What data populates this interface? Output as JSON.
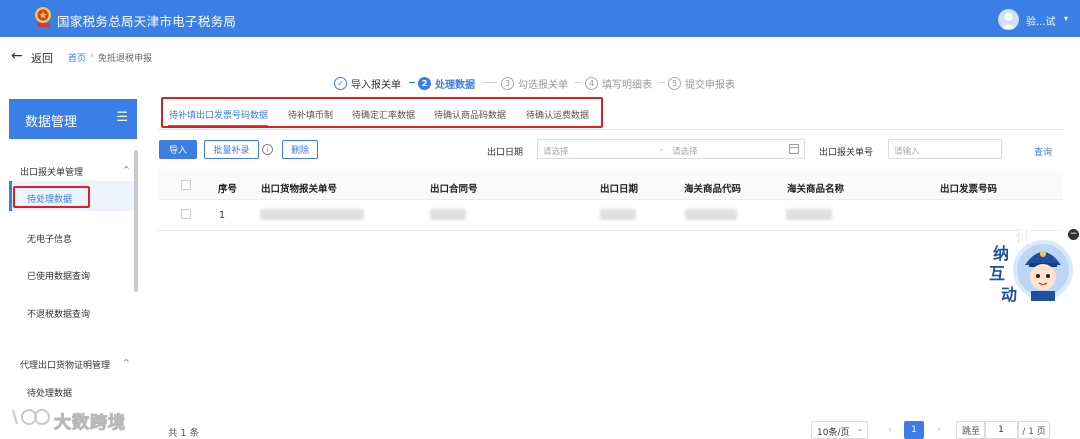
{
  "header": {
    "title": "国家税务总局天津市电子税务局",
    "user_name": "验...试"
  },
  "breadcrumb": {
    "back_label": "返回",
    "home": "首页",
    "separator": "›",
    "current": "免抵退税申报"
  },
  "steps": [
    {
      "num": "✓",
      "label": "导入报关单",
      "state": "done"
    },
    {
      "num": "2",
      "label": "处理数据",
      "state": "active"
    },
    {
      "num": "3",
      "label": "勾选报关单",
      "state": "pending"
    },
    {
      "num": "4",
      "label": "填写明细表",
      "state": "pending"
    },
    {
      "num": "5",
      "label": "提交申报表",
      "state": "pending"
    }
  ],
  "sidebar": {
    "title": "数据管理",
    "groups": [
      {
        "label": "出口报关单管理",
        "items": [
          "待处理数据",
          "无电子信息",
          "已使用数据查询",
          "不退税数据查询"
        ]
      },
      {
        "label": "代理出口货物证明管理",
        "items": [
          "待处理数据"
        ]
      }
    ],
    "active_item": "待处理数据"
  },
  "subtabs": [
    "待补填出口发票号码数据",
    "待补填币制",
    "待确定汇率数据",
    "待确认商品码数据",
    "待确认运费数据"
  ],
  "toolbar": {
    "import_label": "导入",
    "batch_label": "批量补录",
    "delete_label": "删除",
    "info_icon": "i",
    "export_date_label": "出口日期",
    "date_start_placeholder": "请选择",
    "date_sep": "-",
    "date_end_placeholder": "请选择",
    "customs_no_label": "出口报关单号",
    "customs_no_placeholder": "请输入",
    "query_label": "查询"
  },
  "table": {
    "columns": [
      "序号",
      "出口货物报关单号",
      "出口合同号",
      "出口日期",
      "海关商品代码",
      "海关商品名称",
      "出口发票号码"
    ],
    "rows": [
      {
        "index": "1"
      }
    ]
  },
  "pagination": {
    "total": "共 1 条",
    "page_size": "10条/页",
    "prev": "‹",
    "current": "1",
    "next": "›",
    "jump_label": "跳至",
    "jump_value": "1",
    "pages": "/ 1 页"
  },
  "assistant": {
    "chars": [
      "征",
      "纳",
      "互",
      "动"
    ],
    "close": "−"
  },
  "watermark": {
    "text": "大数跨境"
  },
  "colors": {
    "primary": "#3a7ee6",
    "highlight_box": "#e02020"
  }
}
